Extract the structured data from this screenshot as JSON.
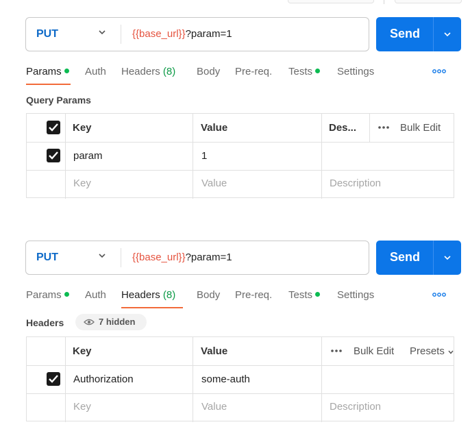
{
  "colors": {
    "accent": "#0c76e8",
    "method": "#0e6ac8",
    "variable": "#e5533f",
    "active_tab_underline": "#f26b3a",
    "status_dot": "#0cbb52"
  },
  "panels": [
    {
      "request": {
        "method": "PUT",
        "url_variable": "{{base_url}}",
        "url_rest": "?param=1",
        "send_label": "Send"
      },
      "tabs": [
        {
          "label": "Params",
          "dot": true
        },
        {
          "label": "Auth"
        },
        {
          "label": "Headers",
          "count": "(8)"
        },
        {
          "label": "Body"
        },
        {
          "label": "Pre-req."
        },
        {
          "label": "Tests",
          "dot": true
        },
        {
          "label": "Settings"
        }
      ],
      "active_tab": "Params",
      "section_title": "Query Params",
      "table": {
        "headers": {
          "key": "Key",
          "value": "Value",
          "description": "Des...",
          "bulk_edit": "Bulk Edit"
        },
        "rows": [
          {
            "checked": true,
            "key": "param",
            "value": "1",
            "description": ""
          }
        ],
        "placeholder": {
          "key": "Key",
          "value": "Value",
          "description": "Description"
        }
      }
    },
    {
      "request": {
        "method": "PUT",
        "url_variable": "{{base_url}}",
        "url_rest": "?param=1",
        "send_label": "Send"
      },
      "tabs": [
        {
          "label": "Params",
          "dot": true
        },
        {
          "label": "Auth"
        },
        {
          "label": "Headers",
          "count": "(8)"
        },
        {
          "label": "Body"
        },
        {
          "label": "Pre-req."
        },
        {
          "label": "Tests",
          "dot": true
        },
        {
          "label": "Settings"
        }
      ],
      "active_tab": "Headers",
      "section_title": "Headers",
      "hidden_badge": "7 hidden",
      "table": {
        "headers": {
          "key": "Key",
          "value": "Value",
          "bulk_edit": "Bulk Edit",
          "presets": "Presets"
        },
        "rows": [
          {
            "checked": true,
            "key": "Authorization",
            "value": "some-auth",
            "description": ""
          }
        ],
        "placeholder": {
          "key": "Key",
          "value": "Value",
          "description": "Description"
        }
      }
    }
  ],
  "icons": {
    "method_dropdown": "chevron-down-icon",
    "send_dropdown": "chevron-down-icon",
    "more": "more-horizontal-icon",
    "eye": "eye-icon",
    "checkbox": "checkmark-icon",
    "row_menu": "ellipsis-icon"
  }
}
